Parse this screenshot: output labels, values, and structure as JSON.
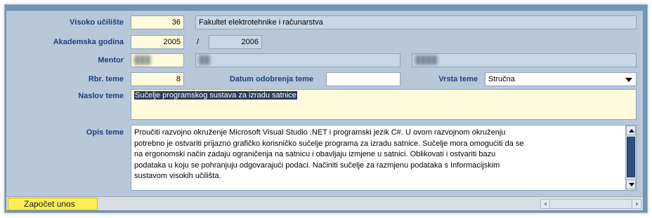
{
  "form": {
    "visoko_uciliste": {
      "label": "Visoko učilište",
      "code": "36",
      "name": "Fakultet elektrotehnike i računarstva"
    },
    "akademska_godina": {
      "label": "Akademska godina",
      "from": "2005",
      "separator": "/",
      "to": "2006"
    },
    "mentor": {
      "label": "Mentor",
      "field1": "███",
      "field2": "██",
      "field3": "████"
    },
    "rbr_teme": {
      "label": "Rbr. teme",
      "value": "8"
    },
    "datum_odobrenja": {
      "label": "Datum odobrenja teme",
      "value": ""
    },
    "vrsta_teme": {
      "label": "Vrsta teme",
      "value": "Stručna"
    },
    "naslov_teme": {
      "label": "Naslov teme",
      "value": "Sučelje programskog sustava za izradu satnice"
    },
    "opis_teme": {
      "label": "Opis teme",
      "lines": [
        "Proučiti razvojno okruženje Microsoft Visual Studio .NET i programski jezik C#. U ovom razvojnom okruženju",
        "potrebno je ostvariti prijazno grafičko korisničko sučelje programa za izradu satnice. Sučelje mora omogućiti da se",
        "na ergonomski način zadaju ograničenja na satnicu i obavljaju izmjene u satnici. Oblikovati i ostvariti bazu",
        "podataka u koju se pohranjuju odgovarajući podaci. Načiniti sučelje za razmjenu podataka s Informacijskim",
        "sustavom visokih učilišta."
      ]
    }
  },
  "bottom": {
    "start_button_label": "Započet unos"
  },
  "colors": {
    "label_color": "#1f3f78",
    "field_yellow": "#fffbdc",
    "field_blue": "#c8d7e5",
    "panel": "#b8c8d8",
    "button_yellow": "#ffee55"
  }
}
